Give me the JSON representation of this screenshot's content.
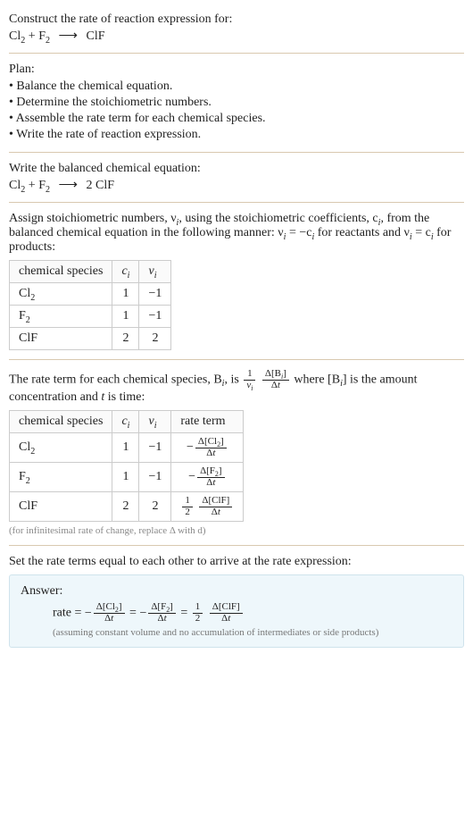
{
  "prompt": {
    "line1": "Construct the rate of reaction expression for:",
    "equation_lhs": "Cl",
    "equation_plus": " + F",
    "equation_rhs": "ClF"
  },
  "plan": {
    "title": "Plan:",
    "items": [
      "Balance the chemical equation.",
      "Determine the stoichiometric numbers.",
      "Assemble the rate term for each chemical species.",
      "Write the rate of reaction expression."
    ]
  },
  "balanced": {
    "title": "Write the balanced chemical equation:",
    "coeff_product": "2"
  },
  "stoich": {
    "intro_a": "Assign stoichiometric numbers, ν",
    "intro_b": ", using the stoichiometric coefficients, c",
    "intro_c": ", from the balanced chemical equation in the following manner: ν",
    "intro_d": " = −c",
    "intro_e": " for reactants and ν",
    "intro_f": " = c",
    "intro_g": " for products:",
    "headers": [
      "chemical species",
      "cᵢ",
      "νᵢ"
    ],
    "rows": [
      {
        "species": "Cl₂",
        "c": "1",
        "v": "−1"
      },
      {
        "species": "F₂",
        "c": "1",
        "v": "−1"
      },
      {
        "species": "ClF",
        "c": "2",
        "v": "2"
      }
    ]
  },
  "rateterm": {
    "intro_a": "The rate term for each chemical species, B",
    "intro_b": ", is ",
    "intro_c": " where [B",
    "intro_d": "] is the amount concentration and ",
    "intro_e": " is time:",
    "headers": [
      "chemical species",
      "cᵢ",
      "νᵢ",
      "rate term"
    ],
    "rows": [
      {
        "species": "Cl₂",
        "c": "1",
        "v": "−1",
        "term_sign": "−",
        "term_conc": "Δ[Cl₂]"
      },
      {
        "species": "F₂",
        "c": "1",
        "v": "−1",
        "term_sign": "−",
        "term_conc": "Δ[F₂]"
      },
      {
        "species": "ClF",
        "c": "2",
        "v": "2",
        "term_coef_num": "1",
        "term_coef_den": "2",
        "term_conc": "Δ[ClF]"
      }
    ],
    "note": "(for infinitesimal rate of change, replace Δ with d)"
  },
  "final": {
    "title": "Set the rate terms equal to each other to arrive at the rate expression:",
    "answer_label": "Answer:",
    "rate_word": "rate = ",
    "note": "(assuming constant volume and no accumulation of intermediates or side products)"
  }
}
